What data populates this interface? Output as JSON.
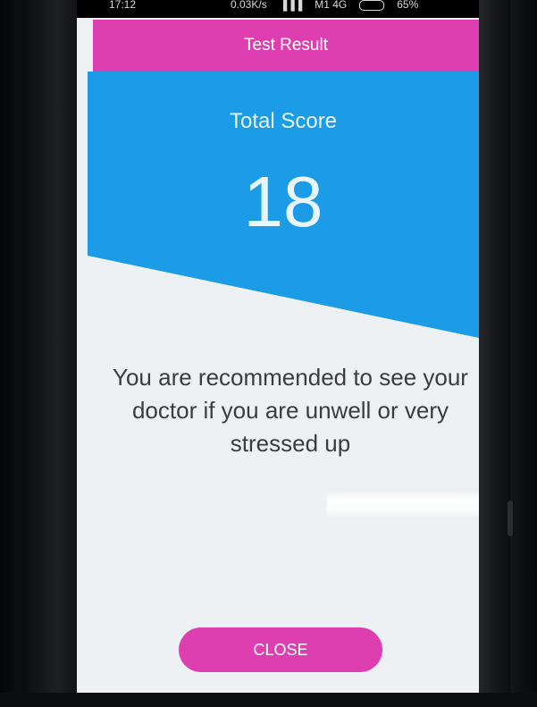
{
  "status_bar": {
    "time": "17:12",
    "network_speed": "0.03K/s",
    "signal": "▐▐▐",
    "carrier": "M1 4G",
    "battery": "65%"
  },
  "app_bar": {
    "title": "Test Result"
  },
  "score": {
    "label": "Total Score",
    "value": "18"
  },
  "result_message": "You are recommended to see your doctor if you are unwell or very stressed up",
  "actions": {
    "close_label": "CLOSE"
  },
  "colors": {
    "app_bar": "#dd3fb1",
    "score_panel": "#1c9be6",
    "background": "#eef1f3",
    "close_button": "#dd3fb1"
  }
}
